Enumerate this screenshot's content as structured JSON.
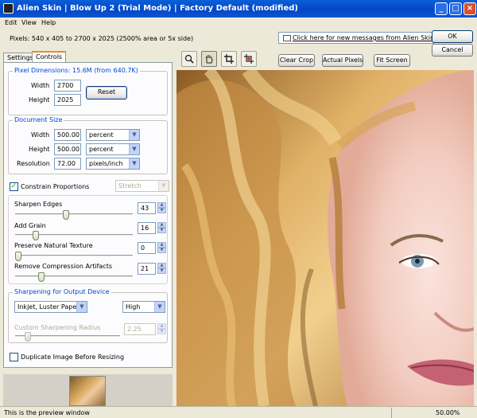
{
  "window": {
    "title": "Alien Skin | Blow Up 2 (Trial Mode) | Factory Default (modified)",
    "min": "_",
    "max": "□",
    "close": "×"
  },
  "menu": [
    "Edit",
    "View",
    "Help"
  ],
  "pixel_info": "Pixels: 540 x 405 to 2700 x 2025 (2500% area or 5x side)",
  "tabs": [
    "Settings",
    "Controls"
  ],
  "pixel_dimensions": {
    "label": "Pixel Dimensions: 15.6M (from 640.7K)",
    "width_label": "Width",
    "width": "2700",
    "height_label": "Height",
    "height": "2025",
    "reset": "Reset"
  },
  "document_size": {
    "label": "Document Size",
    "width_label": "Width",
    "width": "500.00",
    "width_unit": "percent",
    "height_label": "Height",
    "height": "500.00",
    "height_unit": "percent",
    "resolution_label": "Resolution",
    "resolution": "72.00",
    "resolution_unit": "pixels/inch"
  },
  "constrain": {
    "label": "Constrain Proportions",
    "checked": true,
    "mode": "Stretch"
  },
  "sliders": [
    {
      "label": "Sharpen Edges",
      "value": "43",
      "level": 0.43
    },
    {
      "label": "Add Grain",
      "value": "16",
      "level": 0.16
    },
    {
      "label": "Preserve Natural Texture",
      "value": "0",
      "level": 0.0
    },
    {
      "label": "Remove Compression Artifacts",
      "value": "21",
      "level": 0.21
    }
  ],
  "output": {
    "label": "Sharpening for Output Device",
    "device": "Inkjet, Luster Paper",
    "level": "High",
    "radius_label": "Custom Sharpening Radius",
    "radius": "2.25",
    "radius_level": 0.1
  },
  "duplicate": {
    "label": "Duplicate Image Before Resizing",
    "checked": false
  },
  "buttons": {
    "ok": "OK",
    "cancel": "Cancel",
    "clear_crop": "Clear Crop",
    "actual_pixels": "Actual Pixels",
    "fit_screen": "Fit Screen"
  },
  "message_link": "Click here for new messages from Alien Skin",
  "tools": [
    "zoom-icon",
    "hand-icon",
    "crop-icon",
    "crop-zoom-icon"
  ],
  "status": {
    "text": "This is the preview window",
    "zoom": "50.00%"
  },
  "colors": {
    "title_bar": "#0346c8",
    "group_label": "#0046d5",
    "tab_highlight": "#e68b2c"
  }
}
